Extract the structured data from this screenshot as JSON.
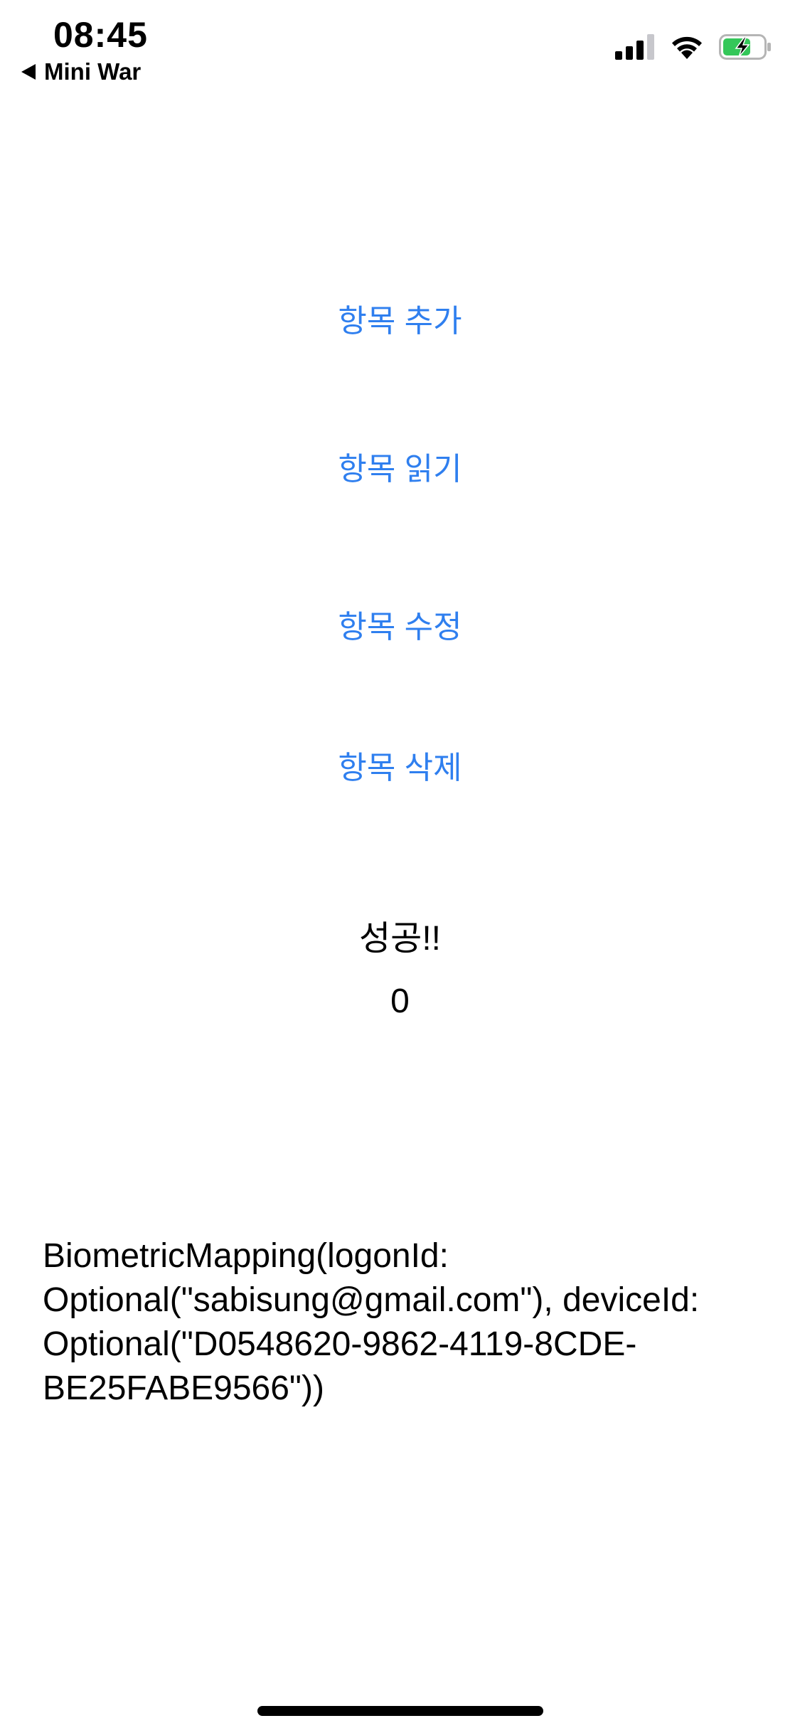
{
  "status_bar": {
    "time": "08:45",
    "back_label": "Mini War",
    "icons": [
      "cellular-signal-icon",
      "wifi-icon",
      "battery-charging-icon"
    ],
    "battery_color": "#34c759"
  },
  "actions": {
    "add_label": "항목 추가",
    "read_label": "항목 읽기",
    "edit_label": "항목 수정",
    "delete_label": "항목 삭제",
    "accent_color": "#2f7fef"
  },
  "result": {
    "status": "성공!!",
    "count": "0"
  },
  "mapping": {
    "text": "BiometricMapping(logonId:\nOptional(\"sabisung@gmail.com\"), deviceId:\nOptional(\"D0548620-9862-4119-8CDE-\nBE25FABE9566\"))"
  }
}
